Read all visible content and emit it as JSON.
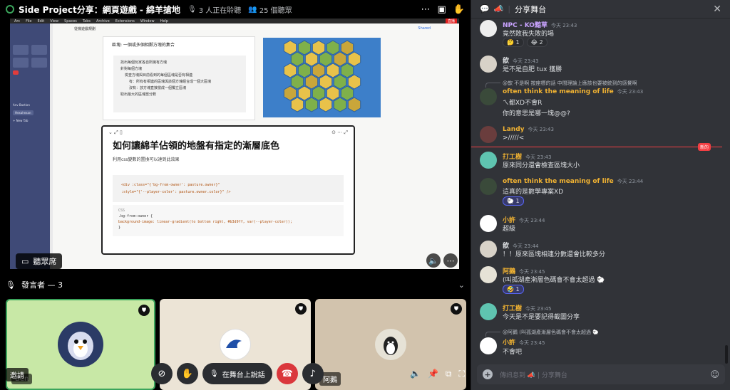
{
  "topbar": {
    "title": "Side Project分享：網頁遊戲 - 綿羊搶地",
    "listening": "3 人正在聆聽",
    "viewers": "25 個聽眾"
  },
  "stage": {
    "mac_menu": [
      "Arc",
      "File",
      "Edit",
      "View",
      "Spaces",
      "Tabs",
      "Archive",
      "Extensions",
      "Window",
      "Help"
    ],
    "live_tag": "直播",
    "doc_breadcrumb": "從機遊戲規劃",
    "shared_label": "Shared",
    "sidebar_items": [
      "Anv Bastion",
      "Hexahexan",
      "+ New Tab"
    ],
    "card1_title": "區塊: 一個或多個相鄰方塊的集合",
    "card1_lines": [
      "找出每個玩家各自所擁有方塊",
      "針對每個方塊",
      "檢查方塊與目前看到的每個區塊是否有相連",
      "有：所有有相連的區塊與該個方塊組合成一個大區塊",
      "沒有：該方塊直接當成一個獨立區塊",
      "取出最大的區塊當分數"
    ],
    "card2_title": "如何讓綿羊佔領的地盤有指定的漸層底色",
    "card2_sub": "利用css變數的置換可以達到此效果",
    "code1_lines": [
      "<div :class=\"{'bg-from-owner': pasture.owner}\"",
      "     :style=\"{'--player-coler': pasture.owner.color}\" />"
    ],
    "code2_lang": "CSS",
    "code2_lines": [
      ".bg-from-owner {",
      "  background-image: linear-gradient(to bottom right, #b3d9ff, var(--player-coler));",
      "}"
    ],
    "viewer_label": "聽眾席"
  },
  "speakers": {
    "label": "發言者 — 3",
    "tiles": [
      {
        "name": "Ben"
      },
      {
        "name": ""
      },
      {
        "name": "阿鵝"
      }
    ],
    "invite_label": "邀請",
    "talk_label": "在舞台上說話"
  },
  "chat": {
    "header": "分享舞台",
    "new_label": "新的",
    "messages": [
      {
        "user": "NPC - KO黯草",
        "ts": "今天 23:43",
        "text": "竟然敗我失敗的場",
        "color": "#c9a3ff",
        "reactions": [
          "🤔 1",
          "😂 2"
        ]
      },
      {
        "user": "歆",
        "ts": "今天 23:43",
        "text": "是不是自肥 tux 獲勝",
        "color": "#dbdee1"
      },
      {
        "reply": "@歆 不是啊 按座標的話 中間理論上應該也要被統到的感覺啊",
        "user": "often think the meaning  of life",
        "ts": "今天 23:43",
        "text": "ㄟ都XD不會R",
        "text2": "你的意思是哪一塊@@?",
        "color": "#f0b232"
      },
      {
        "user": "Landy",
        "ts": "今天 23:43",
        "text": ">/////<",
        "color": "#f0b232"
      },
      {
        "user": "打工樹",
        "ts": "今天 23:43",
        "text": "原來同分還會檢查區塊大小",
        "color": "#f0b232"
      },
      {
        "user": "often think the meaning  of life",
        "ts": "今天 23:44",
        "text": "這真的是數學專案XD",
        "color": "#f0b232",
        "reactions": [
          "🐑 1"
        ]
      },
      {
        "user": "小許",
        "ts": "今天 23:44",
        "text": "超級",
        "color": "#f0b232"
      },
      {
        "user": "歆",
        "ts": "今天 23:44",
        "text": "！！原來區塊相連分數還會比較多分",
        "color": "#dbdee1"
      },
      {
        "user": "阿鵝",
        "ts": "今天 23:45",
        "text": "(叫孤湖產漸層色碼會不會太超過 🐑",
        "color": "#f0b232",
        "reactions": [
          "🤣 1"
        ]
      },
      {
        "user": "打工樹",
        "ts": "今天 23:45",
        "text": "今天是不是要記得截圖分享",
        "color": "#f0b232"
      },
      {
        "reply": "@阿鵝 (叫孤湖產漸層色碼會不會太超過 🐑",
        "user": "小許",
        "ts": "今天 23:45",
        "text": "不會吧",
        "color": "#f0b232"
      }
    ],
    "input_placeholder": "傳訊息到 📣 | 分享舞台"
  }
}
